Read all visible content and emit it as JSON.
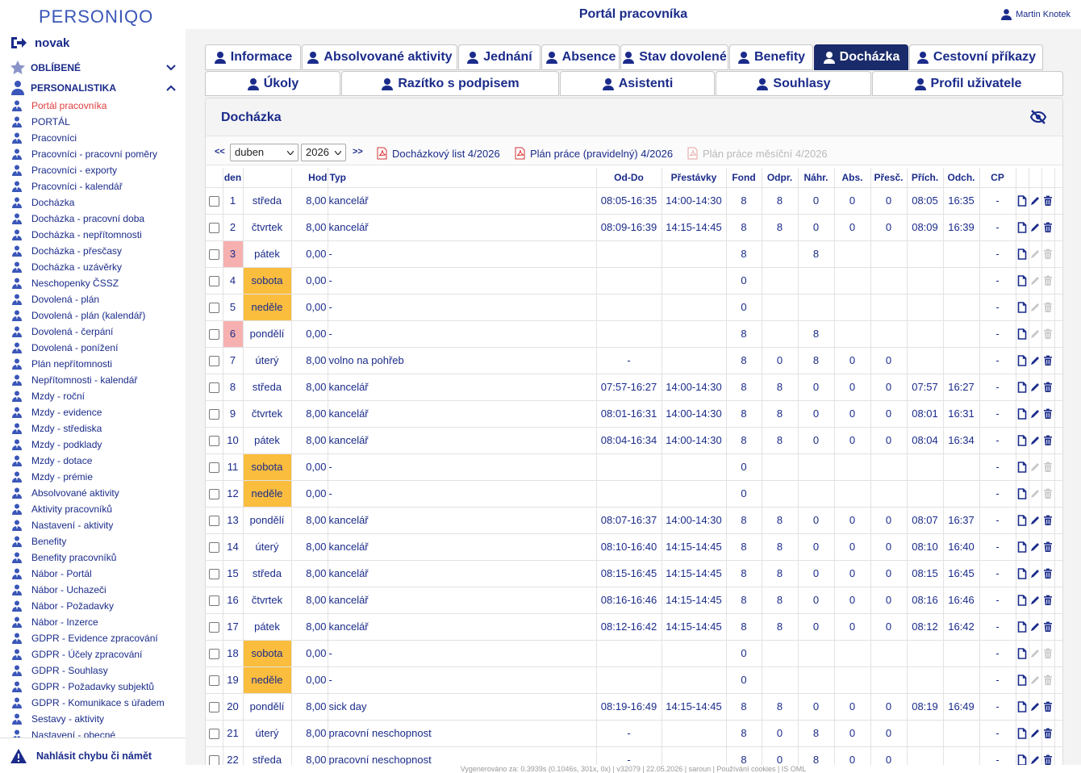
{
  "app": {
    "logo": "PERSONIQO",
    "title": "Portál pracovníka",
    "user": "Martin Knotek",
    "footer": "Vygenerováno za: 0.3939s (0.1046s, 301x, 0x) | v32079 | 22.05.2026 | saroun | Používání cookies | IS OML"
  },
  "sidebar": {
    "username": "novak",
    "favorites": "OBLÍBENÉ",
    "section": "PERSONALISTIKA",
    "items": [
      "Portál pracovníka",
      "PORTÁL",
      "Pracovníci",
      "Pracovníci - pracovní poměry",
      "Pracovníci - exporty",
      "Pracovníci - kalendář",
      "Docházka",
      "Docházka - pracovní doba",
      "Docházka - nepřítomnosti",
      "Docházka - přesčasy",
      "Docházka - uzávěrky",
      "Neschopenky ČSSZ",
      "Dovolená - plán",
      "Dovolená - plán (kalendář)",
      "Dovolená - čerpání",
      "Dovolená - ponížení",
      "Plán nepřítomnosti",
      "Nepřítomnosti - kalendář",
      "Mzdy - roční",
      "Mzdy - evidence",
      "Mzdy - střediska",
      "Mzdy - podklady",
      "Mzdy - dotace",
      "Mzdy - prémie",
      "Absolvované aktivity",
      "Aktivity pracovníků",
      "Nastavení - aktivity",
      "Benefity",
      "Benefity pracovníků",
      "Nábor - Portál",
      "Nábor - Uchazeči",
      "Nábor - Požadavky",
      "Nábor - Inzerce",
      "GDPR - Evidence zpracování",
      "GDPR - Účely zpracování",
      "GDPR - Souhlasy",
      "GDPR - Požadavky subjektů",
      "GDPR - Komunikace s úřadem",
      "Sestavy - aktivity",
      "Nastavení - obecné"
    ],
    "report": "Nahlásit chybu či námět"
  },
  "tabs_row1": [
    "Informace",
    "Absolvované aktivity",
    "Jednání",
    "Absence",
    "Stav dovolené",
    "Benefity",
    "Docházka",
    "Cestovní příkazy"
  ],
  "tabs_row2": [
    "Úkoly",
    "Razítko s podpisem",
    "Asistenti",
    "Souhlasy",
    "Profil uživatele"
  ],
  "panel": {
    "title": "Docházka",
    "prev": "<<",
    "next": ">>",
    "month": "duben",
    "year": "2026",
    "pdf1": "Docházkový list 4/2026",
    "pdf2": "Plán práce (pravidelný) 4/2026",
    "pdf3": "Plán práce měsíční 4/2026"
  },
  "columns": [
    "den",
    "",
    "Hod",
    "Typ",
    "Od-Do",
    "Přestávky",
    "Fond",
    "Odpr.",
    "Náhr.",
    "Abs.",
    "Přesč.",
    "Přích.",
    "Odch.",
    "CP"
  ],
  "rows": [
    {
      "den": "1",
      "day": "středa",
      "hod": "8,00",
      "typ": "kancelář",
      "oddo": "08:05-16:35",
      "prest": "14:00-14:30",
      "fond": "8",
      "odpr": "8",
      "nahr": "0",
      "abs": "0",
      "presc": "0",
      "prich": "08:05",
      "odch": "16:35",
      "cp": "-",
      "kind": "work"
    },
    {
      "den": "2",
      "day": "čtvrtek",
      "hod": "8,00",
      "typ": "kancelář",
      "oddo": "08:09-16:39",
      "prest": "14:15-14:45",
      "fond": "8",
      "odpr": "8",
      "nahr": "0",
      "abs": "0",
      "presc": "0",
      "prich": "08:09",
      "odch": "16:39",
      "cp": "-",
      "kind": "work"
    },
    {
      "den": "3",
      "day": "pátek",
      "hod": "0,00",
      "typ": "-",
      "oddo": "",
      "prest": "",
      "fond": "8",
      "odpr": "",
      "nahr": "8",
      "abs": "",
      "presc": "",
      "prich": "",
      "odch": "",
      "cp": "-",
      "kind": "holiday"
    },
    {
      "den": "4",
      "day": "sobota",
      "hod": "0,00",
      "typ": "-",
      "oddo": "",
      "prest": "",
      "fond": "0",
      "odpr": "",
      "nahr": "",
      "abs": "",
      "presc": "",
      "prich": "",
      "odch": "",
      "cp": "-",
      "kind": "weekend"
    },
    {
      "den": "5",
      "day": "neděle",
      "hod": "0,00",
      "typ": "-",
      "oddo": "",
      "prest": "",
      "fond": "0",
      "odpr": "",
      "nahr": "",
      "abs": "",
      "presc": "",
      "prich": "",
      "odch": "",
      "cp": "-",
      "kind": "weekend"
    },
    {
      "den": "6",
      "day": "pondělí",
      "hod": "0,00",
      "typ": "-",
      "oddo": "",
      "prest": "",
      "fond": "8",
      "odpr": "",
      "nahr": "8",
      "abs": "",
      "presc": "",
      "prich": "",
      "odch": "",
      "cp": "-",
      "kind": "holiday"
    },
    {
      "den": "7",
      "day": "úterý",
      "hod": "8,00",
      "typ": "volno na pohřeb",
      "oddo": "-",
      "prest": "",
      "fond": "8",
      "odpr": "0",
      "nahr": "8",
      "abs": "0",
      "presc": "0",
      "prich": "",
      "odch": "",
      "cp": "-",
      "kind": "work"
    },
    {
      "den": "8",
      "day": "středa",
      "hod": "8,00",
      "typ": "kancelář",
      "oddo": "07:57-16:27",
      "prest": "14:00-14:30",
      "fond": "8",
      "odpr": "8",
      "nahr": "0",
      "abs": "0",
      "presc": "0",
      "prich": "07:57",
      "odch": "16:27",
      "cp": "-",
      "kind": "work"
    },
    {
      "den": "9",
      "day": "čtvrtek",
      "hod": "8,00",
      "typ": "kancelář",
      "oddo": "08:01-16:31",
      "prest": "14:00-14:30",
      "fond": "8",
      "odpr": "8",
      "nahr": "0",
      "abs": "0",
      "presc": "0",
      "prich": "08:01",
      "odch": "16:31",
      "cp": "-",
      "kind": "work"
    },
    {
      "den": "10",
      "day": "pátek",
      "hod": "8,00",
      "typ": "kancelář",
      "oddo": "08:04-16:34",
      "prest": "14:00-14:30",
      "fond": "8",
      "odpr": "8",
      "nahr": "0",
      "abs": "0",
      "presc": "0",
      "prich": "08:04",
      "odch": "16:34",
      "cp": "-",
      "kind": "work"
    },
    {
      "den": "11",
      "day": "sobota",
      "hod": "0,00",
      "typ": "-",
      "oddo": "",
      "prest": "",
      "fond": "0",
      "odpr": "",
      "nahr": "",
      "abs": "",
      "presc": "",
      "prich": "",
      "odch": "",
      "cp": "-",
      "kind": "weekend"
    },
    {
      "den": "12",
      "day": "neděle",
      "hod": "0,00",
      "typ": "-",
      "oddo": "",
      "prest": "",
      "fond": "0",
      "odpr": "",
      "nahr": "",
      "abs": "",
      "presc": "",
      "prich": "",
      "odch": "",
      "cp": "-",
      "kind": "weekend"
    },
    {
      "den": "13",
      "day": "pondělí",
      "hod": "8,00",
      "typ": "kancelář",
      "oddo": "08:07-16:37",
      "prest": "14:00-14:30",
      "fond": "8",
      "odpr": "8",
      "nahr": "0",
      "abs": "0",
      "presc": "0",
      "prich": "08:07",
      "odch": "16:37",
      "cp": "-",
      "kind": "work"
    },
    {
      "den": "14",
      "day": "úterý",
      "hod": "8,00",
      "typ": "kancelář",
      "oddo": "08:10-16:40",
      "prest": "14:15-14:45",
      "fond": "8",
      "odpr": "8",
      "nahr": "0",
      "abs": "0",
      "presc": "0",
      "prich": "08:10",
      "odch": "16:40",
      "cp": "-",
      "kind": "work"
    },
    {
      "den": "15",
      "day": "středa",
      "hod": "8,00",
      "typ": "kancelář",
      "oddo": "08:15-16:45",
      "prest": "14:15-14:45",
      "fond": "8",
      "odpr": "8",
      "nahr": "0",
      "abs": "0",
      "presc": "0",
      "prich": "08:15",
      "odch": "16:45",
      "cp": "-",
      "kind": "work"
    },
    {
      "den": "16",
      "day": "čtvrtek",
      "hod": "8,00",
      "typ": "kancelář",
      "oddo": "08:16-16:46",
      "prest": "14:15-14:45",
      "fond": "8",
      "odpr": "8",
      "nahr": "0",
      "abs": "0",
      "presc": "0",
      "prich": "08:16",
      "odch": "16:46",
      "cp": "-",
      "kind": "work"
    },
    {
      "den": "17",
      "day": "pátek",
      "hod": "8,00",
      "typ": "kancelář",
      "oddo": "08:12-16:42",
      "prest": "14:15-14:45",
      "fond": "8",
      "odpr": "8",
      "nahr": "0",
      "abs": "0",
      "presc": "0",
      "prich": "08:12",
      "odch": "16:42",
      "cp": "-",
      "kind": "work"
    },
    {
      "den": "18",
      "day": "sobota",
      "hod": "0,00",
      "typ": "-",
      "oddo": "",
      "prest": "",
      "fond": "0",
      "odpr": "",
      "nahr": "",
      "abs": "",
      "presc": "",
      "prich": "",
      "odch": "",
      "cp": "-",
      "kind": "weekend"
    },
    {
      "den": "19",
      "day": "neděle",
      "hod": "0,00",
      "typ": "-",
      "oddo": "",
      "prest": "",
      "fond": "0",
      "odpr": "",
      "nahr": "",
      "abs": "",
      "presc": "",
      "prich": "",
      "odch": "",
      "cp": "-",
      "kind": "weekend"
    },
    {
      "den": "20",
      "day": "pondělí",
      "hod": "8,00",
      "typ": "sick day",
      "oddo": "08:19-16:49",
      "prest": "14:15-14:45",
      "fond": "8",
      "odpr": "8",
      "nahr": "0",
      "abs": "0",
      "presc": "0",
      "prich": "08:19",
      "odch": "16:49",
      "cp": "-",
      "kind": "work"
    },
    {
      "den": "21",
      "day": "úterý",
      "hod": "8,00",
      "typ": "pracovní neschopnost",
      "oddo": "-",
      "prest": "",
      "fond": "8",
      "odpr": "0",
      "nahr": "8",
      "abs": "0",
      "presc": "0",
      "prich": "",
      "odch": "",
      "cp": "-",
      "kind": "work"
    },
    {
      "den": "22",
      "day": "středa",
      "hod": "8,00",
      "typ": "pracovní neschopnost",
      "oddo": "-",
      "prest": "",
      "fond": "8",
      "odpr": "0",
      "nahr": "8",
      "abs": "0",
      "presc": "0",
      "prich": "",
      "odch": "",
      "cp": "-",
      "kind": "work"
    }
  ],
  "colors": {
    "navy": "#1a2b8a",
    "weekend": "#fbbd3e",
    "holiday": "#f7b0b0",
    "activeTab": "#1a2b6b",
    "activeMenu": "#e23b3b"
  },
  "icons": {
    "row_actions": [
      "document-icon",
      "pencil-icon",
      "trash-icon"
    ]
  }
}
